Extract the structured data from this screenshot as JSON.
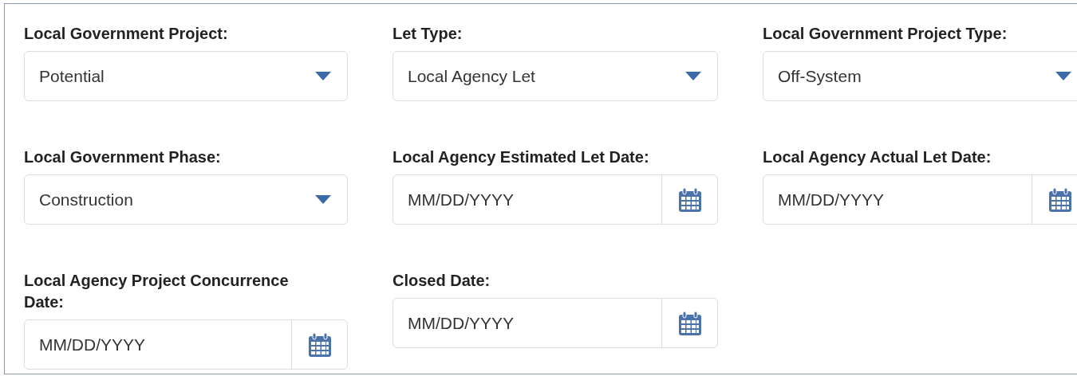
{
  "fields": [
    {
      "label": "Local Government Project:",
      "kind": "dropdown",
      "value": "Potential"
    },
    {
      "label": "Let Type:",
      "kind": "dropdown",
      "value": "Local Agency Let"
    },
    {
      "label": "Local Government Project Type:",
      "kind": "dropdown",
      "value": "Off-System"
    },
    {
      "label": "Local Government Phase:",
      "kind": "dropdown",
      "value": "Construction"
    },
    {
      "label": "Local Agency Estimated Let Date:",
      "kind": "date",
      "placeholder": "MM/DD/YYYY"
    },
    {
      "label": "Local Agency Actual Let Date:",
      "kind": "date",
      "placeholder": "MM/DD/YYYY"
    },
    {
      "label": "Local Agency Project Concurrence Date:",
      "kind": "date",
      "placeholder": "MM/DD/YYYY"
    },
    {
      "label": "Closed Date:",
      "kind": "date",
      "placeholder": "MM/DD/YYYY"
    }
  ]
}
